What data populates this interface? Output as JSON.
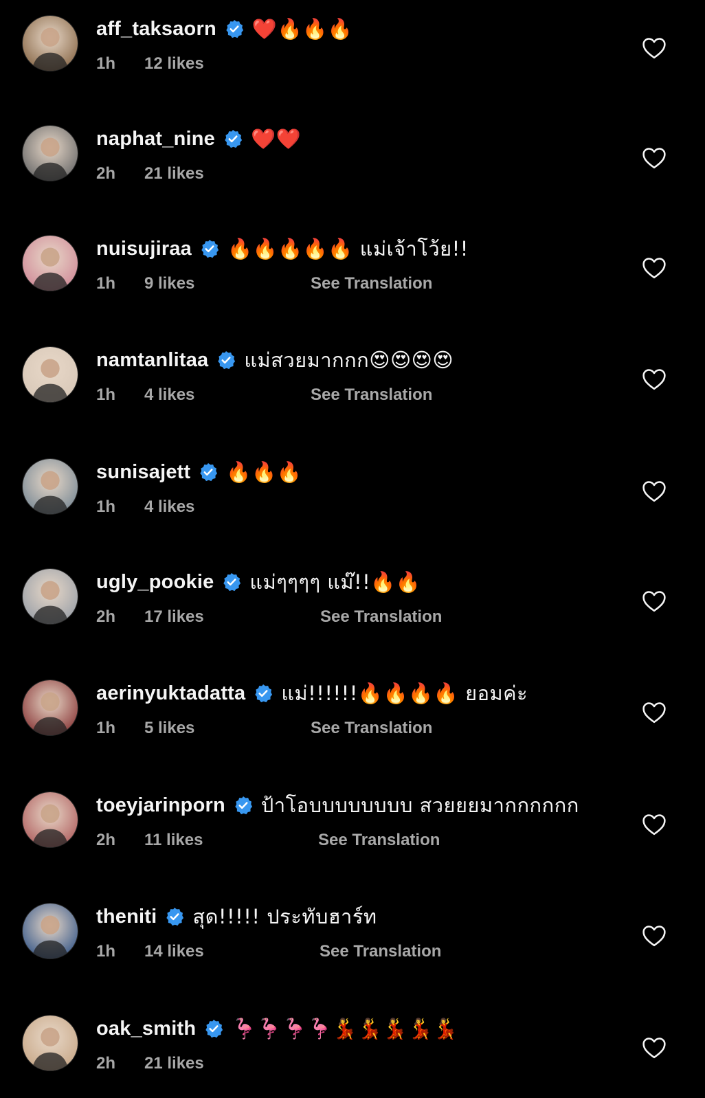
{
  "comments": [
    {
      "username": "aff_taksaorn",
      "text": "❤️🔥🔥🔥",
      "time": "1h",
      "likes": "12 likes",
      "translation": "",
      "avatar_icon": "avatar-photo",
      "avatar_color": "#8a6a4a"
    },
    {
      "username": "naphat_nine",
      "text": "❤️❤️",
      "time": "2h",
      "likes": "21 likes",
      "translation": "",
      "avatar_icon": "avatar-photo",
      "avatar_color": "#6a6a6a"
    },
    {
      "username": "nuisujiraa",
      "text": "🔥🔥🔥🔥🔥 แม่เจ้าโว้ย!!",
      "time": "1h",
      "likes": "9 likes",
      "translation": "See Translation",
      "avatar_icon": "avatar-photo",
      "avatar_color": "#d08a98"
    },
    {
      "username": "namtanlitaa",
      "text": "แม่สวยมากกก😍😍😍😍",
      "time": "1h",
      "likes": "4 likes",
      "translation": "See Translation",
      "avatar_icon": "avatar-photo",
      "avatar_color": "#d8c8b8"
    },
    {
      "username": "sunisajett",
      "text": "🔥🔥🔥",
      "time": "1h",
      "likes": "4 likes",
      "translation": "",
      "avatar_icon": "avatar-photo",
      "avatar_color": "#7a8a96"
    },
    {
      "username": "ugly_pookie",
      "text": "แม่ๆๆๆๆ แม๊!!🔥🔥",
      "time": "2h",
      "likes": "17 likes",
      "translation": "See Translation",
      "avatar_icon": "avatar-photo",
      "avatar_color": "#9aa0a8"
    },
    {
      "username": "aerinyuktadatta",
      "text": "แม่!!!!!!🔥🔥🔥🔥 ยอมค่ะ",
      "time": "1h",
      "likes": "5 likes",
      "translation": "See Translation",
      "avatar_icon": "avatar-photo",
      "avatar_color": "#8a3a3a"
    },
    {
      "username": "toeyjarinporn",
      "text": "ป้าโอบบบบบบบบ สวยยยมากกกกกก",
      "time": "2h",
      "likes": "11 likes",
      "translation": "See Translation",
      "avatar_icon": "avatar-photo",
      "avatar_color": "#b06060"
    },
    {
      "username": "theniti",
      "text": "สุด!!!!! ประทับฮาร์ท",
      "time": "1h",
      "likes": "14 likes",
      "translation": "See Translation",
      "avatar_icon": "avatar-photo",
      "avatar_color": "#3a5a8a"
    },
    {
      "username": "oak_smith",
      "text": "🦩🦩🦩🦩💃💃💃💃💃",
      "time": "2h",
      "likes": "21 likes",
      "translation": "",
      "avatar_icon": "avatar-photo",
      "avatar_color": "#c8a888"
    }
  ],
  "icons": {
    "verified": "verified-badge-icon",
    "like": "heart-outline-icon"
  },
  "colors": {
    "background": "#000000",
    "text": "#f5f5f5",
    "secondary": "#a8a8a8",
    "verified": "#3897f0"
  }
}
